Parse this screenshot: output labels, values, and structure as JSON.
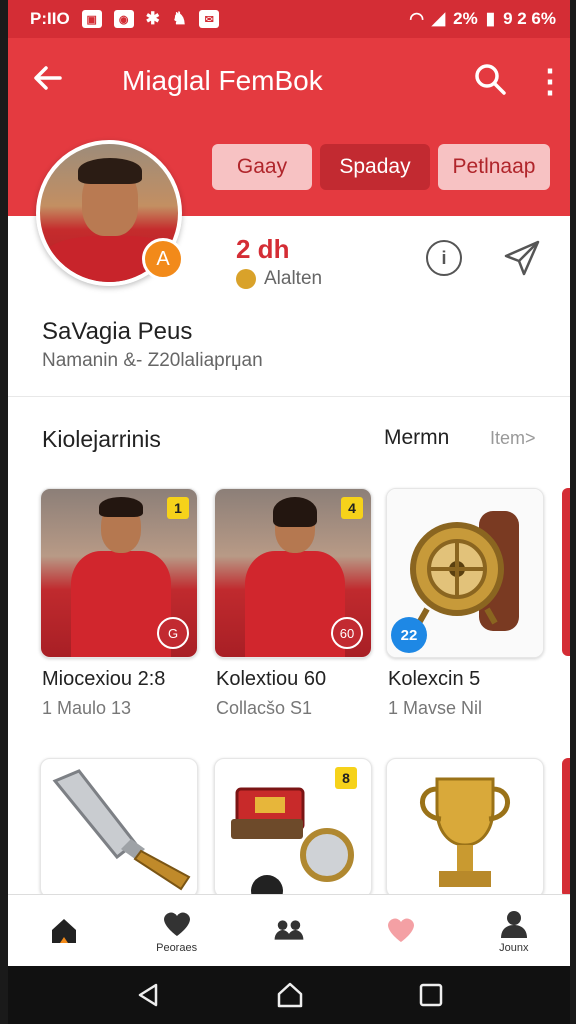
{
  "status_bar": {
    "time": "P:IIO",
    "battery_pct": "2%",
    "extra": "9 2 6%"
  },
  "app_bar": {
    "title": "Miaglal FemBok",
    "back_icon": "arrow-left-icon",
    "search_icon": "search-icon",
    "more_icon": "more-vert-icon"
  },
  "profile": {
    "tabs": [
      {
        "label": "Gaay",
        "active": false
      },
      {
        "label": "Spaday",
        "active": true
      },
      {
        "label": "Petlnaap",
        "active": false
      }
    ],
    "badge": "A",
    "stat_value": "2 dh",
    "stat_label": "Alalten",
    "name": "SaVagia Peus",
    "subtitle": "Namanin &- Z20lalіaprџan"
  },
  "collection": {
    "title": "Kiolejarrinis",
    "right_label": "Mermn",
    "link_label": "Item>",
    "cards": [
      {
        "title": "Miocexiou 2:8",
        "sub": "1 Maulo 13",
        "badge_top": "1",
        "badge_bottom": "G"
      },
      {
        "title": "Kolextiou 60",
        "sub": "Collacšo S1",
        "badge_top": "4",
        "badge_bottom": "60"
      },
      {
        "title": "Kolexcin 5",
        "sub": "1 Mavse Nil",
        "badge_bottom": "22"
      }
    ],
    "row2_badge": "8"
  },
  "bottom_nav": [
    {
      "label": "",
      "icon": "home-icon"
    },
    {
      "label": "Peoraes",
      "icon": "heart-icon"
    },
    {
      "label": "",
      "icon": "group-icon"
    },
    {
      "label": "",
      "icon": "heart-outline-icon"
    },
    {
      "label": "Jounx",
      "icon": "person-icon"
    }
  ],
  "colors": {
    "primary": "#e43a40",
    "primary_dark": "#c22a31",
    "accent": "#f28a1a"
  }
}
